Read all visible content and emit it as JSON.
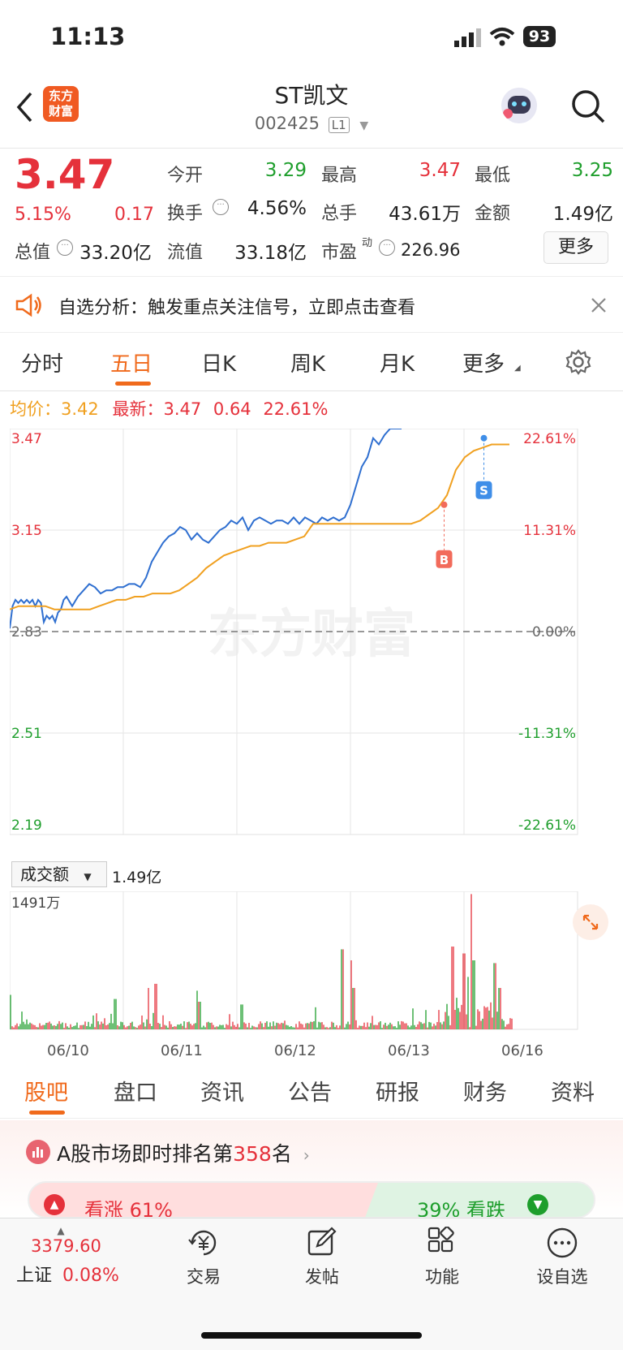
{
  "status": {
    "time": "11:13",
    "battery": "93"
  },
  "header": {
    "logo_line1": "东方",
    "logo_line2": "财富",
    "title": "ST凯文",
    "code": "002425",
    "level_badge": "L1"
  },
  "quote": {
    "price": "3.47",
    "change_pct": "5.15%",
    "change": "0.17",
    "open_label": "今开",
    "open": "3.29",
    "high_label": "最高",
    "high": "3.47",
    "low_label": "最低",
    "low": "3.25",
    "turnover_label": "换手",
    "turnover": "4.56%",
    "volume_label": "总手",
    "volume": "43.61万",
    "amount_label": "金额",
    "amount": "1.49亿",
    "mktcap_label": "总值",
    "mktcap": "33.20亿",
    "float_label": "流值",
    "float_cap": "33.18亿",
    "pe_label": "市盈",
    "pe_sup": "动",
    "pe": "226.96",
    "more_label": "更多"
  },
  "notice": {
    "text": "自选分析：触发重点关注信号，立即点击查看"
  },
  "tabs": [
    "分时",
    "五日",
    "日K",
    "周K",
    "月K",
    "更多"
  ],
  "active_tab": "五日",
  "infoline": {
    "avg_label": "均价：",
    "avg": "3.42",
    "latest_label": "最新：",
    "latest": "3.47",
    "chg": "0.64",
    "pct": "22.61%"
  },
  "chart_data": {
    "type": "line",
    "y_ticks_left": [
      "3.47",
      "3.15",
      "2.83",
      "2.51",
      "2.19"
    ],
    "y_ticks_right": [
      "22.61%",
      "11.31%",
      "0.00%",
      "-11.31%",
      "-22.61%"
    ],
    "x_labels": [
      "06/10",
      "06/11",
      "06/12",
      "06/13",
      "06/16"
    ],
    "prev_close": 2.83,
    "ylim": [
      2.19,
      3.47
    ],
    "watermark": "东方财富",
    "price_x": [
      0,
      0.5,
      1,
      1.5,
      2,
      2.5,
      3,
      3.5,
      4,
      4.5,
      5,
      5.5,
      6,
      6.5,
      7,
      7.5,
      8,
      8.5,
      9,
      9.5,
      10,
      11,
      12,
      13,
      14,
      15,
      16,
      17,
      18,
      19,
      20,
      21,
      22,
      23,
      24,
      25,
      26,
      27,
      28,
      29,
      30,
      31,
      32,
      33,
      34,
      35,
      36,
      37,
      38,
      39,
      40,
      41,
      42,
      43,
      44,
      45,
      46,
      47,
      48,
      49,
      50,
      51,
      52,
      53,
      54,
      55,
      56,
      57,
      58,
      59,
      60,
      61,
      62,
      63,
      64,
      65,
      66,
      67,
      68,
      69,
      70,
      71,
      72,
      73,
      74,
      75,
      76,
      77,
      78,
      79,
      80,
      81,
      82,
      83,
      84,
      85,
      86,
      87,
      88,
      89,
      90,
      91,
      92,
      93,
      94,
      95,
      96,
      97,
      98,
      99,
      100
    ],
    "price": [
      2.84,
      2.91,
      2.93,
      2.92,
      2.93,
      2.92,
      2.93,
      2.92,
      2.93,
      2.91,
      2.93,
      2.92,
      2.86,
      2.88,
      2.87,
      2.88,
      2.86,
      2.89,
      2.9,
      2.93,
      2.94,
      2.91,
      2.94,
      2.96,
      2.98,
      2.97,
      2.95,
      2.96,
      2.96,
      2.97,
      2.97,
      2.98,
      2.98,
      2.97,
      3.0,
      3.05,
      3.08,
      3.11,
      3.13,
      3.14,
      3.16,
      3.15,
      3.12,
      3.14,
      3.12,
      3.11,
      3.13,
      3.15,
      3.16,
      3.18,
      3.17,
      3.19,
      3.15,
      3.18,
      3.19,
      3.18,
      3.17,
      3.18,
      3.18,
      3.17,
      3.19,
      3.17,
      3.19,
      3.18,
      3.17,
      3.19,
      3.18,
      3.19,
      3.18,
      3.19,
      3.23,
      3.29,
      3.35,
      3.38,
      3.44,
      3.42,
      3.45,
      3.47,
      3.47,
      3.47
    ],
    "avg_price": [
      2.9,
      2.91,
      2.91,
      2.91,
      2.91,
      2.9,
      2.9,
      2.9,
      2.9,
      2.9,
      2.91,
      2.92,
      2.93,
      2.93,
      2.94,
      2.94,
      2.95,
      2.95,
      2.95,
      2.96,
      2.98,
      3.0,
      3.03,
      3.05,
      3.07,
      3.08,
      3.09,
      3.1,
      3.1,
      3.11,
      3.11,
      3.11,
      3.12,
      3.13,
      3.17,
      3.17,
      3.17,
      3.17,
      3.17,
      3.17,
      3.17,
      3.17,
      3.17,
      3.17,
      3.17,
      3.17,
      3.18,
      3.2,
      3.22,
      3.26,
      3.34,
      3.38,
      3.4,
      3.41,
      3.42,
      3.42,
      3.42
    ],
    "markers": [
      {
        "label": "B",
        "price": 3.23
      },
      {
        "label": "S",
        "price": 3.44
      }
    ]
  },
  "volume": {
    "selector": "成交额",
    "value": "1.49亿",
    "max_label": "1491万"
  },
  "bottom_tabs": [
    "股吧",
    "盘口",
    "资讯",
    "公告",
    "研报",
    "财务",
    "资料"
  ],
  "active_bottom_tab": "股吧",
  "rank": {
    "prefix": "A股市场即时排名第",
    "num": "358",
    "suffix": "名",
    "up_label": "看涨 61%",
    "down_label": "39% 看跌"
  },
  "toolbar": {
    "index_value": "3379.60",
    "index_name": "上证",
    "index_pct": "0.08%",
    "trade": "交易",
    "post": "发帖",
    "func": "功能",
    "watch": "设自选"
  },
  "colors": {
    "up": "#e5313b",
    "down": "#1e9e2c",
    "accent": "#f06a1c",
    "price_line": "#2f6fd0",
    "avg_line": "#f0a020"
  }
}
